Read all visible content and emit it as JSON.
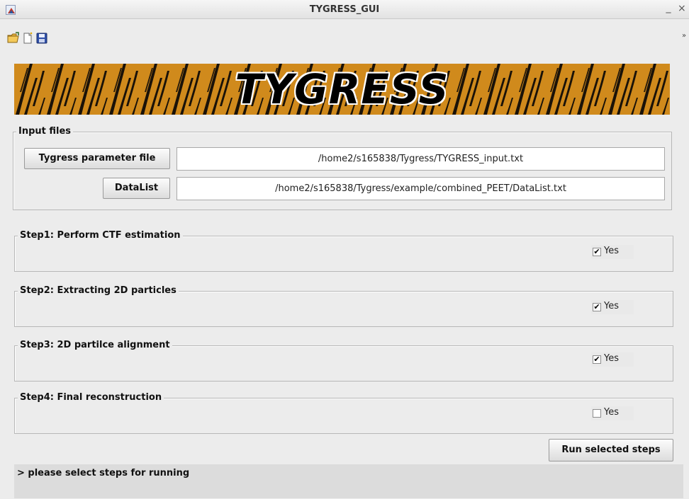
{
  "window": {
    "title": "TYGRESS_GUI",
    "minimize_glyph": "_",
    "close_glyph": "×"
  },
  "toolbar": {
    "icons": [
      "open-folder-icon",
      "new-file-icon",
      "save-icon"
    ],
    "overflow_glyph": "»"
  },
  "banner": {
    "text": "TYGRESS",
    "colors": {
      "base": "#d08a1c",
      "stripes": "#1a1208",
      "text": "#000000",
      "outline": "#ffffff"
    }
  },
  "input_files": {
    "title": "Input files",
    "param_button_label": "Tygress parameter file",
    "param_path": "/home2/s165838/Tygress/TYGRESS_input.txt",
    "datalist_button_label": "DataList",
    "datalist_path": "/home2/s165838/Tygress/example/combined_PEET/DataList.txt"
  },
  "steps": [
    {
      "title": "Step1: Perform CTF estimation",
      "option_label": "Yes",
      "checked": true
    },
    {
      "title": "Step2: Extracting 2D particles",
      "option_label": "Yes",
      "checked": true
    },
    {
      "title": "Step3: 2D partilce alignment",
      "option_label": "Yes",
      "checked": true
    },
    {
      "title": "Step4: Final reconstruction",
      "option_label": "Yes",
      "checked": false
    }
  ],
  "run_button_label": "Run selected steps",
  "status_text": "> please select steps for running"
}
